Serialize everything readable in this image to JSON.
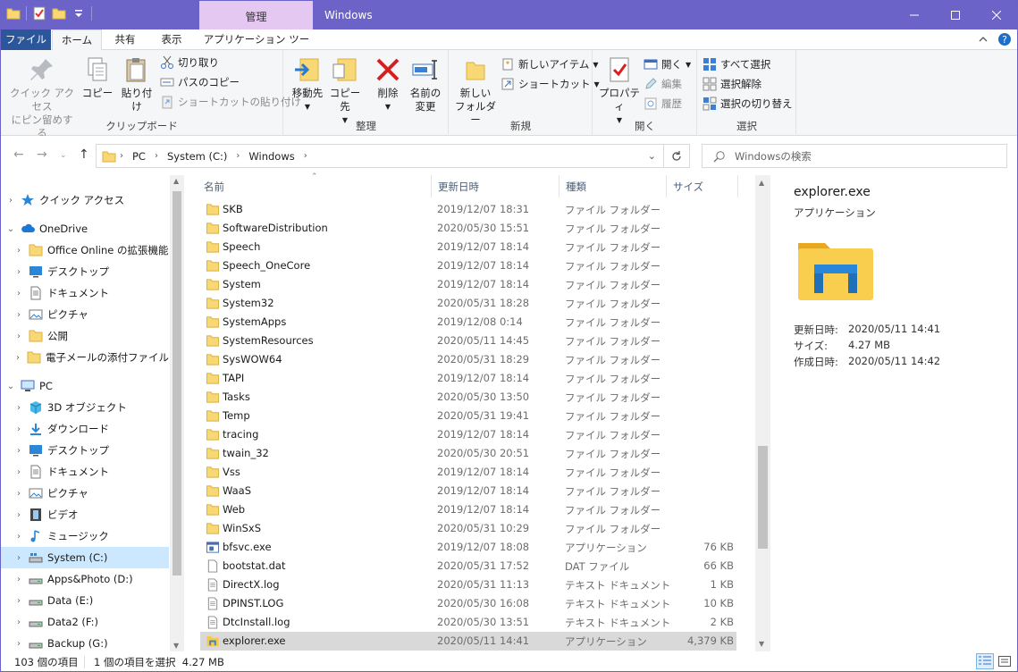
{
  "titlebar": {
    "manage_tab": "管理",
    "title": "Windows",
    "accent": "#6b63c8"
  },
  "tabs": [
    "ファイル",
    "ホーム",
    "共有",
    "表示",
    "アプリケーション ツール"
  ],
  "ribbon": {
    "clipboard": {
      "label": "クリップボード",
      "pin_line1": "クイック アクセス",
      "pin_line2": "にピン留めする",
      "copy": "コピー",
      "paste": "貼り付け",
      "cut": "切り取り",
      "copy_path": "パスのコピー",
      "paste_shortcut": "ショートカットの貼り付け"
    },
    "organize": {
      "label": "整理",
      "move_to": "移動先",
      "copy_to": "コピー先",
      "delete": "削除",
      "rename_line1": "名前の",
      "rename_line2": "変更"
    },
    "new": {
      "label": "新規",
      "new_folder_line1": "新しい",
      "new_folder_line2": "フォルダー",
      "new_item": "新しいアイテム",
      "easy_access": "ショートカット"
    },
    "open": {
      "label": "開く",
      "properties": "プロパティ",
      "open": "開く",
      "edit": "編集",
      "history": "履歴"
    },
    "select": {
      "label": "選択",
      "select_all": "すべて選択",
      "select_none": "選択解除",
      "invert": "選択の切り替え"
    }
  },
  "address": {
    "crumbs": [
      "PC",
      "System (C:)",
      "Windows"
    ],
    "search_placeholder": "Windowsの検索"
  },
  "nav": [
    {
      "label": "クイック アクセス",
      "icon": "star-icon",
      "indent": 0,
      "arrow": "›"
    },
    {
      "label": "OneDrive",
      "icon": "cloud-icon",
      "indent": 0,
      "arrow": "⌄"
    },
    {
      "label": "Office Online の拡張機能",
      "icon": "folder-icon",
      "indent": 1,
      "arrow": "›"
    },
    {
      "label": "デスクトップ",
      "icon": "desktop-icon",
      "indent": 1,
      "arrow": "›"
    },
    {
      "label": "ドキュメント",
      "icon": "document-icon",
      "indent": 1,
      "arrow": "›"
    },
    {
      "label": "ピクチャ",
      "icon": "pictures-icon",
      "indent": 1,
      "arrow": "›"
    },
    {
      "label": "公開",
      "icon": "folder-icon",
      "indent": 1,
      "arrow": "›"
    },
    {
      "label": "電子メールの添付ファイル",
      "icon": "folder-icon",
      "indent": 1,
      "arrow": "›"
    },
    {
      "label": "PC",
      "icon": "pc-icon",
      "indent": 0,
      "arrow": "⌄"
    },
    {
      "label": "3D オブジェクト",
      "icon": "cube-icon",
      "indent": 1,
      "arrow": "›"
    },
    {
      "label": "ダウンロード",
      "icon": "download-icon",
      "indent": 1,
      "arrow": "›"
    },
    {
      "label": "デスクトップ",
      "icon": "desktop-icon",
      "indent": 1,
      "arrow": "›"
    },
    {
      "label": "ドキュメント",
      "icon": "document-icon",
      "indent": 1,
      "arrow": "›"
    },
    {
      "label": "ピクチャ",
      "icon": "pictures-icon",
      "indent": 1,
      "arrow": "›"
    },
    {
      "label": "ビデオ",
      "icon": "video-icon",
      "indent": 1,
      "arrow": "›"
    },
    {
      "label": "ミュージック",
      "icon": "music-icon",
      "indent": 1,
      "arrow": "›"
    },
    {
      "label": "System (C:)",
      "icon": "drive-c-icon",
      "indent": 1,
      "arrow": "›",
      "selected": true
    },
    {
      "label": "Apps&Photo (D:)",
      "icon": "drive-icon",
      "indent": 1,
      "arrow": "›"
    },
    {
      "label": "Data (E:)",
      "icon": "drive-icon",
      "indent": 1,
      "arrow": "›"
    },
    {
      "label": "Data2 (F:)",
      "icon": "drive-icon",
      "indent": 1,
      "arrow": "›"
    },
    {
      "label": "Backup (G:)",
      "icon": "drive-icon",
      "indent": 1,
      "arrow": "›"
    }
  ],
  "columns": {
    "name": "名前",
    "date": "更新日時",
    "type": "種類",
    "size": "サイズ"
  },
  "files": [
    {
      "name": "SKB",
      "date": "2019/12/07 18:31",
      "type": "ファイル フォルダー",
      "size": "",
      "icon": "folder"
    },
    {
      "name": "SoftwareDistribution",
      "date": "2020/05/30 15:51",
      "type": "ファイル フォルダー",
      "size": "",
      "icon": "folder"
    },
    {
      "name": "Speech",
      "date": "2019/12/07 18:14",
      "type": "ファイル フォルダー",
      "size": "",
      "icon": "folder"
    },
    {
      "name": "Speech_OneCore",
      "date": "2019/12/07 18:14",
      "type": "ファイル フォルダー",
      "size": "",
      "icon": "folder"
    },
    {
      "name": "System",
      "date": "2019/12/07 18:14",
      "type": "ファイル フォルダー",
      "size": "",
      "icon": "folder"
    },
    {
      "name": "System32",
      "date": "2020/05/31 18:28",
      "type": "ファイル フォルダー",
      "size": "",
      "icon": "folder"
    },
    {
      "name": "SystemApps",
      "date": "2019/12/08 0:14",
      "type": "ファイル フォルダー",
      "size": "",
      "icon": "folder"
    },
    {
      "name": "SystemResources",
      "date": "2020/05/11 14:45",
      "type": "ファイル フォルダー",
      "size": "",
      "icon": "folder"
    },
    {
      "name": "SysWOW64",
      "date": "2020/05/31 18:29",
      "type": "ファイル フォルダー",
      "size": "",
      "icon": "folder"
    },
    {
      "name": "TAPI",
      "date": "2019/12/07 18:14",
      "type": "ファイル フォルダー",
      "size": "",
      "icon": "folder"
    },
    {
      "name": "Tasks",
      "date": "2020/05/30 13:50",
      "type": "ファイル フォルダー",
      "size": "",
      "icon": "folder"
    },
    {
      "name": "Temp",
      "date": "2020/05/31 19:41",
      "type": "ファイル フォルダー",
      "size": "",
      "icon": "folder"
    },
    {
      "name": "tracing",
      "date": "2019/12/07 18:14",
      "type": "ファイル フォルダー",
      "size": "",
      "icon": "folder"
    },
    {
      "name": "twain_32",
      "date": "2020/05/30 20:51",
      "type": "ファイル フォルダー",
      "size": "",
      "icon": "folder"
    },
    {
      "name": "Vss",
      "date": "2019/12/07 18:14",
      "type": "ファイル フォルダー",
      "size": "",
      "icon": "folder"
    },
    {
      "name": "WaaS",
      "date": "2019/12/07 18:14",
      "type": "ファイル フォルダー",
      "size": "",
      "icon": "folder"
    },
    {
      "name": "Web",
      "date": "2019/12/07 18:14",
      "type": "ファイル フォルダー",
      "size": "",
      "icon": "folder"
    },
    {
      "name": "WinSxS",
      "date": "2020/05/31 10:29",
      "type": "ファイル フォルダー",
      "size": "",
      "icon": "folder"
    },
    {
      "name": "bfsvc.exe",
      "date": "2019/12/07 18:08",
      "type": "アプリケーション",
      "size": "76 KB",
      "icon": "app"
    },
    {
      "name": "bootstat.dat",
      "date": "2020/05/31 17:52",
      "type": "DAT ファイル",
      "size": "66 KB",
      "icon": "file"
    },
    {
      "name": "DirectX.log",
      "date": "2020/05/31 11:13",
      "type": "テキスト ドキュメント",
      "size": "1 KB",
      "icon": "text"
    },
    {
      "name": "DPINST.LOG",
      "date": "2020/05/30 16:08",
      "type": "テキスト ドキュメント",
      "size": "10 KB",
      "icon": "text"
    },
    {
      "name": "DtcInstall.log",
      "date": "2020/05/30 13:51",
      "type": "テキスト ドキュメント",
      "size": "2 KB",
      "icon": "text"
    },
    {
      "name": "explorer.exe",
      "date": "2020/05/11 14:41",
      "type": "アプリケーション",
      "size": "4,379 KB",
      "icon": "explorer",
      "selected": true
    }
  ],
  "preview": {
    "name": "explorer.exe",
    "type": "アプリケーション",
    "props": [
      {
        "label": "更新日時:",
        "value": "2020/05/11 14:41"
      },
      {
        "label": "サイズ:",
        "value": "4.27 MB"
      },
      {
        "label": "作成日時:",
        "value": "2020/05/11 14:42"
      }
    ]
  },
  "status": {
    "count": "103 個の項目",
    "selection": "1 個の項目を選択  4.27 MB"
  }
}
